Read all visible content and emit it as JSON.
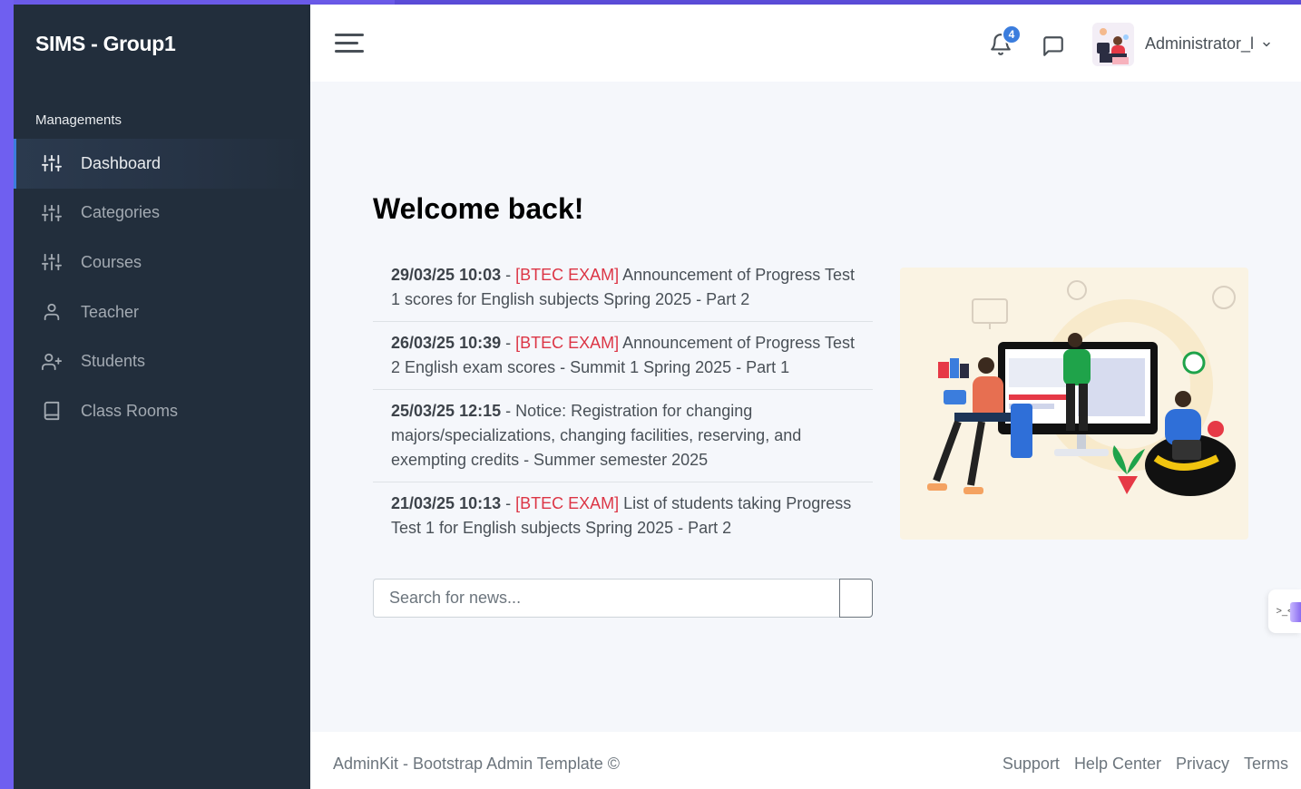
{
  "app": {
    "brand": "SIMS - Group1"
  },
  "sidebar": {
    "header": "Managements",
    "items": [
      {
        "label": "Dashboard",
        "icon": "sliders-icon",
        "active": true
      },
      {
        "label": "Categories",
        "icon": "sliders-icon",
        "active": false
      },
      {
        "label": "Courses",
        "icon": "sliders-icon",
        "active": false
      },
      {
        "label": "Teacher",
        "icon": "user-icon",
        "active": false
      },
      {
        "label": "Students",
        "icon": "user-plus-icon",
        "active": false
      },
      {
        "label": "Class Rooms",
        "icon": "book-icon",
        "active": false
      }
    ]
  },
  "navbar": {
    "notifications_count": "4",
    "user_name": "Administrator_l"
  },
  "main": {
    "welcome": "Welcome back!",
    "news": [
      {
        "date": "29/03/25 10:03",
        "sep": " - ",
        "tag": "[BTEC EXAM]",
        "text": " Announcement of Progress Test 1 scores for English subjects Spring 2025 - Part 2"
      },
      {
        "date": "26/03/25 10:39",
        "sep": " - ",
        "tag": "[BTEC EXAM]",
        "text": " Announcement of Progress Test 2 English exam scores - Summit 1 Spring 2025 - Part 1"
      },
      {
        "date": "25/03/25 12:15",
        "sep": " - ",
        "tag": "",
        "text": "Notice: Registration for changing majors/specializations, changing facilities, reserving, and exempting credits - Summer semester 2025"
      },
      {
        "date": "21/03/25 10:13",
        "sep": " - ",
        "tag": "[BTEC EXAM]",
        "text": " List of students taking Progress Test 1 for English subjects Spring 2025 - Part 2"
      }
    ],
    "search": {
      "placeholder": "Search for news...",
      "value": ""
    }
  },
  "footer": {
    "left": "AdminKit - Bootstrap Admin Template ©",
    "links": [
      "Support",
      "Help Center",
      "Privacy",
      "Terms"
    ]
  },
  "colors": {
    "sidebar_bg": "#222e3c",
    "accent": "#3b7ddd",
    "tag_red": "#dc3545",
    "main_bg": "#f5f7fb"
  }
}
